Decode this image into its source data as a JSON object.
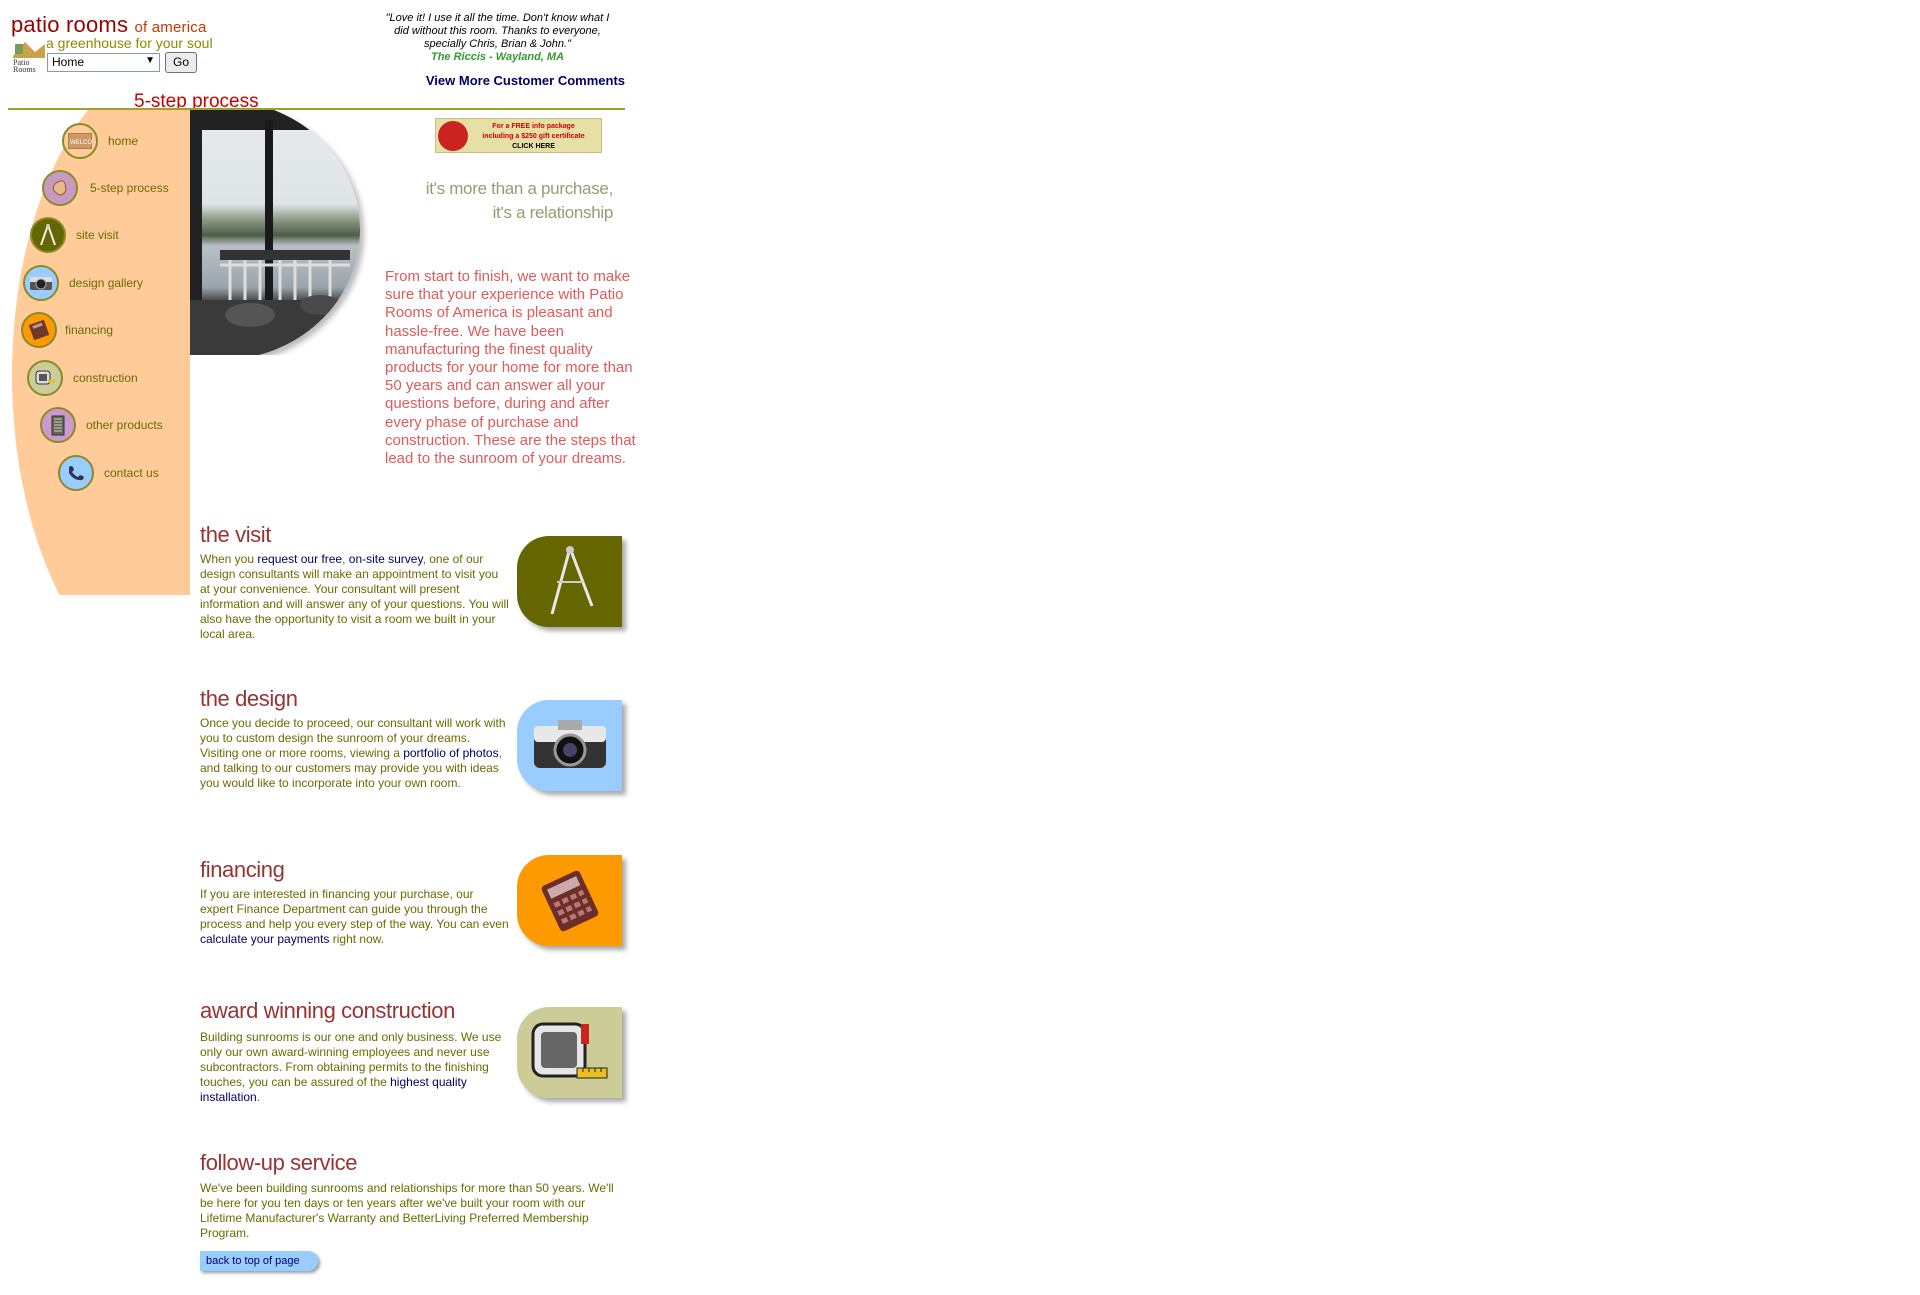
{
  "brand": {
    "name": "patio rooms",
    "name_suffix": "of america",
    "tagline": "a greenhouse for your soul",
    "mark_text": "Patio Rooms"
  },
  "nav_select": {
    "value": "Home",
    "go_label": "Go"
  },
  "testimonial": {
    "quote": "\"Love it! I use it all the time. Don't know what I did without this room. Thanks to everyone, specially Chris, Brian & John.\"",
    "author": "The Riccis - Wayland, MA",
    "more_link": "View More Customer Comments"
  },
  "page_heading": "5-step process",
  "sidebar": {
    "items": [
      {
        "label": "home",
        "icon": "welcome-mat-icon",
        "glyph": "WELCOME"
      },
      {
        "label": "5-step process",
        "icon": "hand-icon",
        "glyph": "✋"
      },
      {
        "label": "site visit",
        "icon": "compass-icon",
        "glyph": "⋀"
      },
      {
        "label": "design gallery",
        "icon": "camera-icon",
        "glyph": "📷"
      },
      {
        "label": "financing",
        "icon": "calculator-icon",
        "glyph": "▦"
      },
      {
        "label": "construction",
        "icon": "tape-measure-icon",
        "glyph": "◨"
      },
      {
        "label": "other products",
        "icon": "building-icon",
        "glyph": "▥"
      },
      {
        "label": "contact us",
        "icon": "phone-icon",
        "glyph": "☎"
      }
    ]
  },
  "promo": {
    "line1": "For a FREE info package",
    "line2": "including a $250 gift certificate",
    "line3": "CLICK HERE"
  },
  "slogan": {
    "line1": "it's more than a purchase,",
    "line2": "it's a relationship"
  },
  "intro": "From start to finish, we want to make sure that your experience with Patio Rooms of America is pleasant and hassle-free. We have been manufacturing the finest quality products for your home for more than 50 years and can answer all your questions before, during and after every phase of purchase and construction. These are the steps that lead to the sunroom of your dreams.",
  "sections": {
    "visit": {
      "title": "the visit",
      "text_before": "When you ",
      "link1": "request our free",
      "sep": ", ",
      "link2": "on-site survey",
      "text_after": ", one of our design consultants will make an appointment to visit you at your convenience. Your consultant will present information and will answer any of your questions. You will also have the opportunity to visit a room we built in your local area.",
      "icon": "compass-icon",
      "color": "#666600"
    },
    "design": {
      "title": "the design",
      "text_before": "Once you decide to proceed, our consultant will work with you to custom design the sunroom of your dreams. Visiting one or more rooms, viewing a ",
      "link": "portfolio of photos",
      "text_after": ", and talking to our customers may provide you with ideas you would like to incorporate into your own room.",
      "icon": "camera-icon",
      "color": "#99ccff"
    },
    "financing": {
      "title": "financing",
      "text_before": "If you are interested in financing your purchase, our expert Finance Department can guide you through the process and help you every step of the way. You can even ",
      "link": "calculate your payments",
      "text_after": " right now.",
      "icon": "calculator-icon",
      "color": "#ff9900"
    },
    "construction": {
      "title": "award winning construction",
      "text_before": "Building sunrooms is our one and only business. We use only our own award-winning employees and never use subcontractors. From obtaining permits to the finishing touches, you can be assured of the ",
      "link": "highest quality installation",
      "text_after": ".",
      "icon": "tape-measure-icon",
      "color": "#cccc99"
    },
    "followup": {
      "title": "follow-up service",
      "text": "We've been building sunrooms and relationships for more than 50 years. We'll be here for you ten days or ten years after we've built your room with our Lifetime Manufacturer's Warranty and BetterLiving Preferred Membership Program."
    }
  },
  "back_to_top": "back to top of page",
  "colors": {
    "brand_red": "#990000",
    "olive": "#6b6b00",
    "peach": "#ffcc99",
    "link_navy": "#000066",
    "intro_pink": "#e05a5a"
  }
}
